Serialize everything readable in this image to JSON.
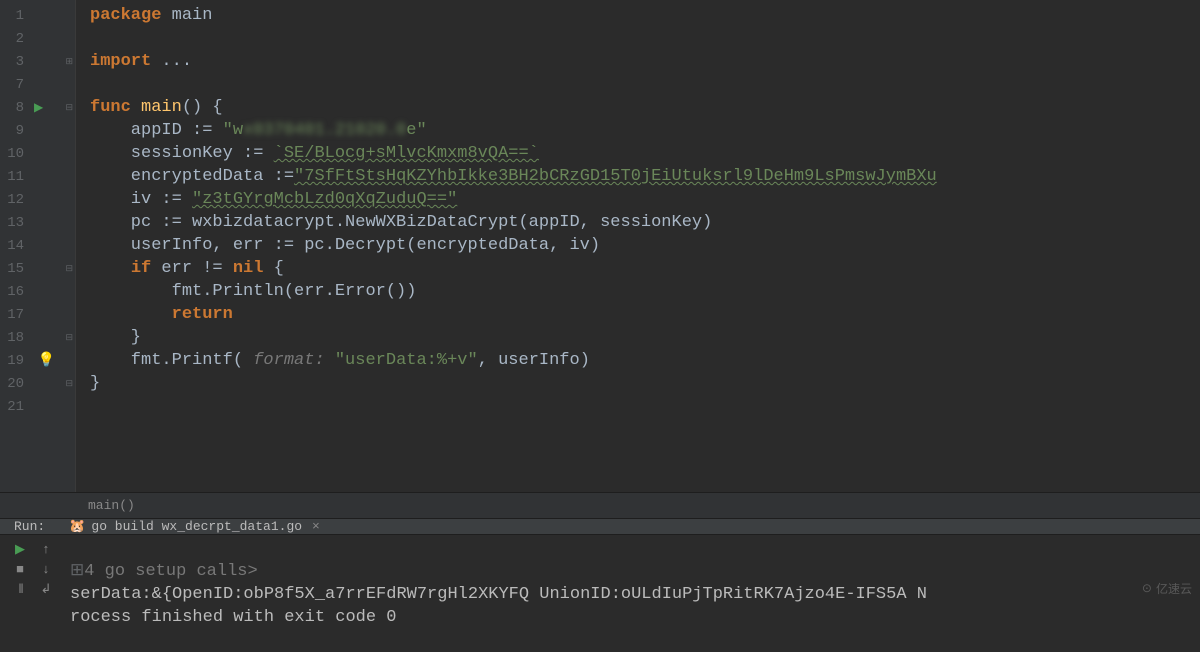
{
  "gutter": {
    "lines": [
      "1",
      "2",
      "3",
      "7",
      "8",
      "9",
      "10",
      "11",
      "12",
      "13",
      "14",
      "15",
      "16",
      "17",
      "18",
      "19",
      "20",
      "21"
    ],
    "runLine": "8",
    "bulbLine": "19",
    "foldPlusLines": [
      "3"
    ],
    "foldMinusLines": [
      "8",
      "15",
      "18",
      "20"
    ]
  },
  "code": {
    "l1_kw1": "package",
    "l1_id": " main",
    "l3_kw1": "import",
    "l3_rest": " ...",
    "l8_kw1": "func",
    "l8_fn": " main",
    "l8_rest": "() {",
    "l9_pre": "    appID := ",
    "l9_str_a": "\"w",
    "l9_blur": "x0370401.21020.0",
    "l9_str_b": "e\"",
    "l10_pre": "    sessionKey := ",
    "l10_str": "`SE/BLocg+sMlvcKmxm8vQA==`",
    "l11_pre": "    encryptedData :=",
    "l11_str": "\"7SfFtStsHqKZYhbIkke3BH2bCRzGD15T0jEiUtuksrl9lDeHm9LsPmswJymBXu",
    "l12_pre": "    iv := ",
    "l12_str": "\"z3tGYrgMcbLzd0qXqZuduQ==\"",
    "l13": "    pc := wxbizdatacrypt.NewWXBizDataCrypt(appID, sessionKey)",
    "l14": "    userInfo, err := pc.Decrypt(encryptedData, iv)",
    "l15_kw": "if",
    "l15_rest": " err != ",
    "l15_nil": "nil",
    "l15_brace": " {",
    "l16": "        fmt.Println(err.Error())",
    "l17_kw": "return",
    "l18": "    }",
    "l19_pre": "    fmt.Printf( ",
    "l19_hint": "format: ",
    "l19_str": "\"userData:%+v\"",
    "l19_rest": ", userInfo)",
    "l20": "}"
  },
  "breadcrumb": {
    "text": "main()"
  },
  "run": {
    "label": "Run:",
    "tabIcon": "🐹",
    "tabTitle": "go build wx_decrpt_data1.go",
    "tabClose": "×",
    "output": {
      "line1_hint": "4 go setup calls>",
      "line2": "serData:&{OpenID:obP8f5X_a7rrEFdRW7rgHl2XKYFQ UnionID:oULdIuPjTpRitRK7Ajzo4E-IFS5A N",
      "line3": "rocess finished with exit code 0"
    }
  },
  "watermark": {
    "text": "亿速云"
  }
}
